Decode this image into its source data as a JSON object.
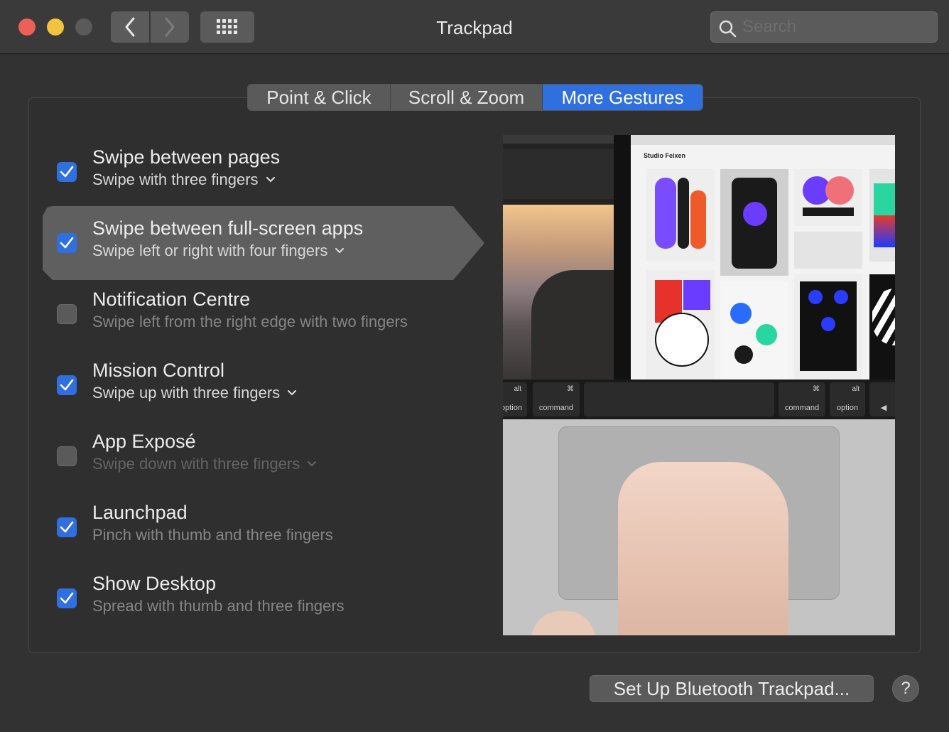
{
  "window": {
    "title": "Trackpad",
    "search_placeholder": "Search"
  },
  "tabs": [
    {
      "label": "Point & Click",
      "selected": false
    },
    {
      "label": "Scroll & Zoom",
      "selected": false
    },
    {
      "label": "More Gestures",
      "selected": true
    }
  ],
  "gestures": [
    {
      "title": "Swipe between pages",
      "subtitle": "Swipe with three fingers",
      "checked": true,
      "has_menu": true
    },
    {
      "title": "Swipe between full-screen apps",
      "subtitle": "Swipe left or right with four fingers",
      "checked": true,
      "has_menu": true,
      "selected": true
    },
    {
      "title": "Notification Centre",
      "subtitle": "Swipe left from the right edge with two fingers",
      "checked": false,
      "has_menu": false
    },
    {
      "title": "Mission Control",
      "subtitle": "Swipe up with three fingers",
      "checked": true,
      "has_menu": true
    },
    {
      "title": "App Exposé",
      "subtitle": "Swipe down with three fingers",
      "checked": false,
      "has_menu": true,
      "disabled": true
    },
    {
      "title": "Launchpad",
      "subtitle": "Pinch with thumb and three fingers",
      "checked": true,
      "has_menu": false
    },
    {
      "title": "Show Desktop",
      "subtitle": "Spread with thumb and three fingers",
      "checked": true,
      "has_menu": false
    }
  ],
  "preview": {
    "site_brand": "Studio Feixen",
    "keys": [
      {
        "symbol": "alt",
        "label": "option"
      },
      {
        "symbol": "⌘",
        "label": "command"
      },
      {
        "symbol": "⌘",
        "label": "command"
      },
      {
        "symbol": "alt",
        "label": "option"
      }
    ]
  },
  "footer": {
    "bluetooth_button": "Set Up Bluetooth Trackpad...",
    "help_label": "?"
  },
  "colors": {
    "accent": "#2f6fe0",
    "close": "#ee5f57",
    "minimize": "#f1c33f",
    "window_bg": "#323232"
  }
}
